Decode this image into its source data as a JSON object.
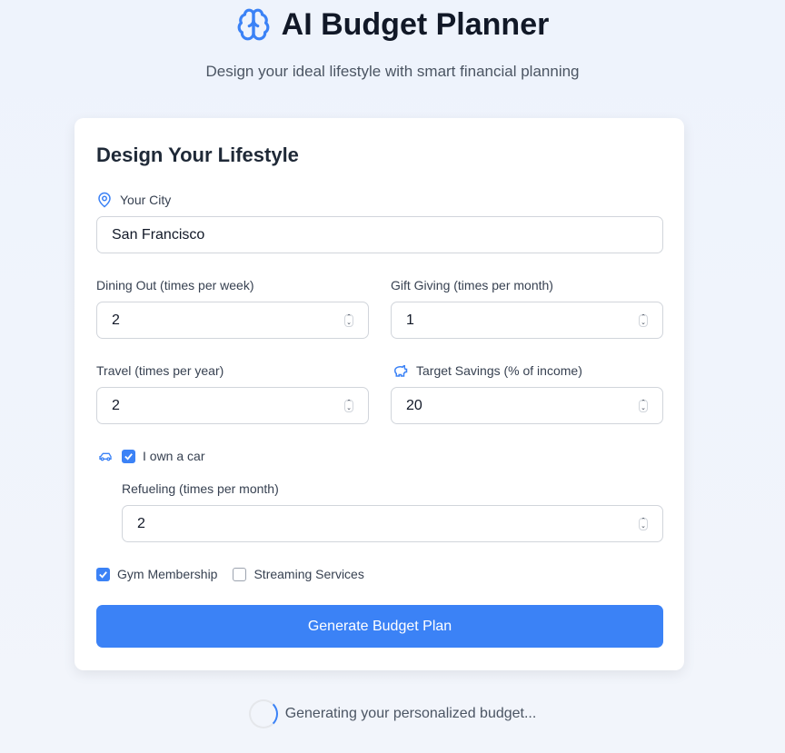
{
  "header": {
    "title": "AI Budget Planner",
    "subtitle": "Design your ideal lifestyle with smart financial planning",
    "icon": "brain-icon"
  },
  "form": {
    "title": "Design Your Lifestyle",
    "city": {
      "label": "Your City",
      "value": "San Francisco"
    },
    "dining": {
      "label": "Dining Out (times per week)",
      "value": "2"
    },
    "gifts": {
      "label": "Gift Giving (times per month)",
      "value": "1"
    },
    "travel": {
      "label": "Travel (times per year)",
      "value": "2"
    },
    "savings": {
      "label": "Target Savings (% of income)",
      "value": "20"
    },
    "car": {
      "label": "I own a car",
      "checked": true
    },
    "refuel": {
      "label": "Refueling (times per month)",
      "value": "2"
    },
    "gym": {
      "label": "Gym Membership",
      "checked": true
    },
    "streaming": {
      "label": "Streaming Services",
      "checked": false
    },
    "submit": "Generate Budget Plan"
  },
  "status": "Generating your personalized budget...",
  "colors": {
    "accent": "#3b82f6"
  }
}
